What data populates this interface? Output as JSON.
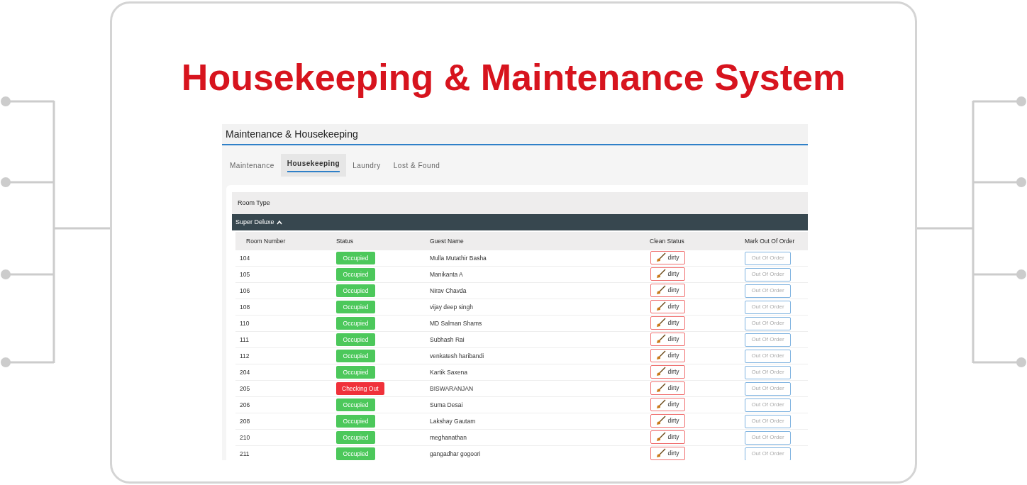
{
  "headline": "Housekeeping & Maintenance System",
  "app": {
    "title": "Maintenance & Housekeeping",
    "tabs": [
      {
        "label": "Maintenance",
        "selected": false
      },
      {
        "label": "Housekeeping",
        "selected": true
      },
      {
        "label": "Laundry",
        "selected": false
      },
      {
        "label": "Lost & Found",
        "selected": false
      }
    ],
    "filter_label": "Room Type",
    "group": {
      "label": "Super Deluxe",
      "expanded": true
    },
    "table": {
      "columns": [
        "Room Number",
        "Status",
        "Guest Name",
        "Clean Status",
        "Mark Out Of Order"
      ],
      "rows": [
        {
          "room": "104",
          "status": "Occupied",
          "kind": "occupied",
          "guest": "Mulla Mutathir Basha",
          "clean": "dirty",
          "action": "Out Of Order"
        },
        {
          "room": "105",
          "status": "Occupied",
          "kind": "occupied",
          "guest": "Manikanta A",
          "clean": "dirty",
          "action": "Out Of Order"
        },
        {
          "room": "106",
          "status": "Occupied",
          "kind": "occupied",
          "guest": "Nirav Chavda",
          "clean": "dirty",
          "action": "Out Of Order"
        },
        {
          "room": "108",
          "status": "Occupied",
          "kind": "occupied",
          "guest": "vijay deep singh",
          "clean": "dirty",
          "action": "Out Of Order"
        },
        {
          "room": "110",
          "status": "Occupied",
          "kind": "occupied",
          "guest": "MD Salman Shams",
          "clean": "dirty",
          "action": "Out Of Order"
        },
        {
          "room": "111",
          "status": "Occupied",
          "kind": "occupied",
          "guest": "Subhash Rai",
          "clean": "dirty",
          "action": "Out Of Order"
        },
        {
          "room": "112",
          "status": "Occupied",
          "kind": "occupied",
          "guest": "venkatesh haribandi",
          "clean": "dirty",
          "action": "Out Of Order"
        },
        {
          "room": "204",
          "status": "Occupied",
          "kind": "occupied",
          "guest": "Kartik Saxena",
          "clean": "dirty",
          "action": "Out Of Order"
        },
        {
          "room": "205",
          "status": "Checking Out",
          "kind": "checking_out",
          "guest": "BISWARANJAN",
          "clean": "dirty",
          "action": "Out Of Order"
        },
        {
          "room": "206",
          "status": "Occupied",
          "kind": "occupied",
          "guest": "Suma Desai",
          "clean": "dirty",
          "action": "Out Of Order"
        },
        {
          "room": "208",
          "status": "Occupied",
          "kind": "occupied",
          "guest": "Lakshay Gautam",
          "clean": "dirty",
          "action": "Out Of Order"
        },
        {
          "room": "210",
          "status": "Occupied",
          "kind": "occupied",
          "guest": "meghanathan",
          "clean": "dirty",
          "action": "Out Of Order"
        },
        {
          "room": "211",
          "status": "Occupied",
          "kind": "occupied",
          "guest": "gangadhar gogoori",
          "clean": "dirty",
          "action": "Out Of Order"
        }
      ]
    }
  }
}
